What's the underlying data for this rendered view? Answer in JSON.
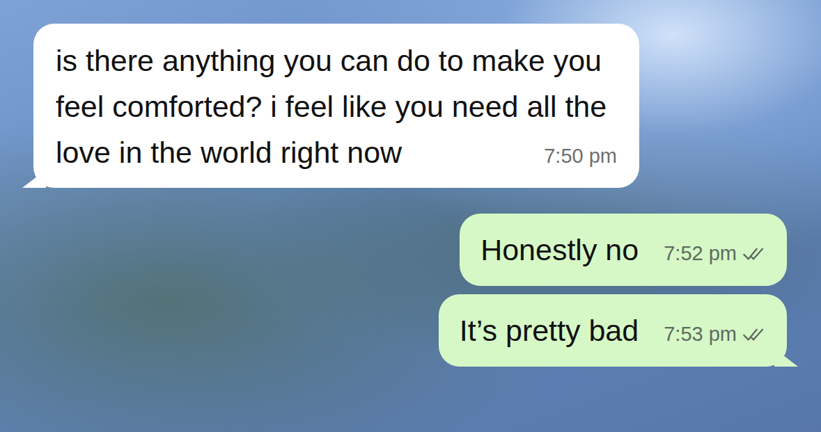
{
  "messages": [
    {
      "kind": "incoming",
      "text": "is there anything you can do to make you feel comforted? i feel like you need all the love in the world right now",
      "time": "7:50 pm"
    },
    {
      "kind": "outgoing",
      "text": "Honestly no",
      "time": "7:52 pm",
      "read": false
    },
    {
      "kind": "outgoing",
      "text": "It’s pretty bad",
      "time": "7:53 pm",
      "read": false
    }
  ]
}
